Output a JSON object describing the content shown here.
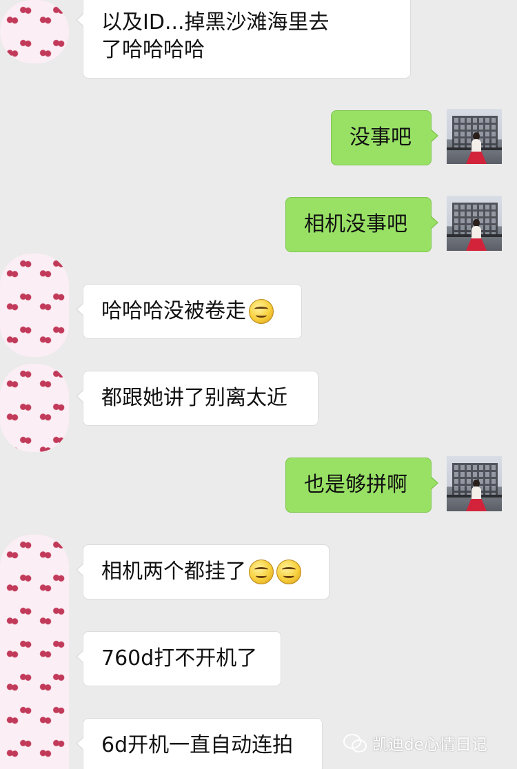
{
  "chat": {
    "messages": [
      {
        "side": "in",
        "lines": [
          "以及ID...掉黑沙滩海里去",
          "了哈哈哈哈"
        ]
      },
      {
        "side": "out",
        "text": "没事吧"
      },
      {
        "side": "out",
        "text": "相机没事吧"
      },
      {
        "side": "in",
        "text": "哈哈哈没被卷走",
        "emoji_count": 1
      },
      {
        "side": "in",
        "text": "都跟她讲了别离太近"
      },
      {
        "side": "out",
        "text": "也是够拼啊"
      },
      {
        "side": "in",
        "text": "相机两个都挂了",
        "emoji_count": 2
      },
      {
        "side": "in",
        "text": "760d打不开机了"
      },
      {
        "side": "in",
        "text": "6d开机一直自动连拍"
      }
    ],
    "emoji": "smile-emoji"
  },
  "watermark": {
    "text": "凯迪de心情日记",
    "icon": "wechat-icon"
  },
  "colors": {
    "background": "#ebebeb",
    "incoming_bubble": "#ffffff",
    "outgoing_bubble": "#98e165"
  }
}
